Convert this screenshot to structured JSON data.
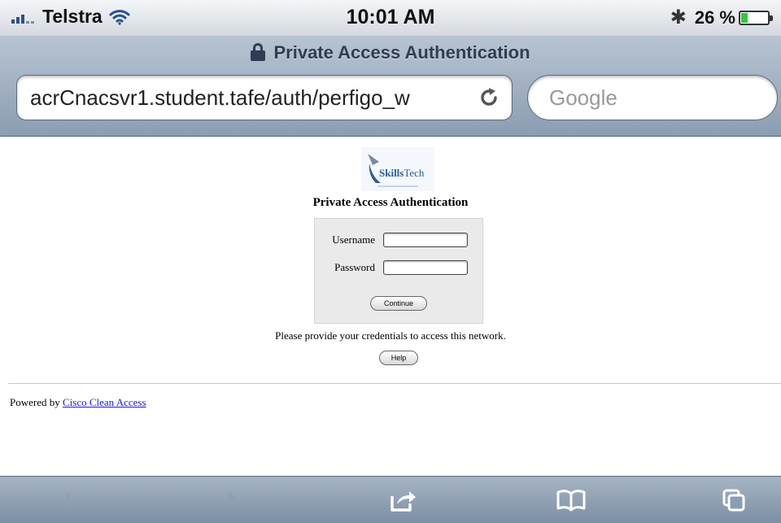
{
  "status_bar": {
    "carrier": "Telstra",
    "time": "10:01 AM",
    "battery_text": "26 %",
    "battery_level": 0.26,
    "signal_bars_active": 3,
    "icons": [
      "signal-bars-icon",
      "wifi-icon",
      "bluetooth-icon",
      "battery-icon"
    ]
  },
  "browser": {
    "page_title": "Private Access Authentication",
    "url": "acrCnacsvr1.student.tafe/auth/perfigo_w",
    "search_placeholder": "Google"
  },
  "page": {
    "logo_text": "SkillsTech",
    "heading": "Private Access Authentication",
    "username_label": "Username",
    "username_value": "",
    "password_label": "Password",
    "password_value": "",
    "continue_label": "Continue",
    "instructions": "Please provide your credentials to access this network.",
    "help_label": "Help",
    "footer_prefix": "Powered by",
    "footer_link": "Cisco Clean Access"
  },
  "toolbar": {
    "items": [
      "back-icon",
      "forward-icon",
      "share-icon",
      "bookmarks-icon",
      "pages-icon"
    ]
  },
  "colors": {
    "link": "#1a1aee",
    "chrome_blue": "#8b9db2",
    "login_box_bg": "#eaeaea",
    "logo_blue": "#2c5c98"
  }
}
